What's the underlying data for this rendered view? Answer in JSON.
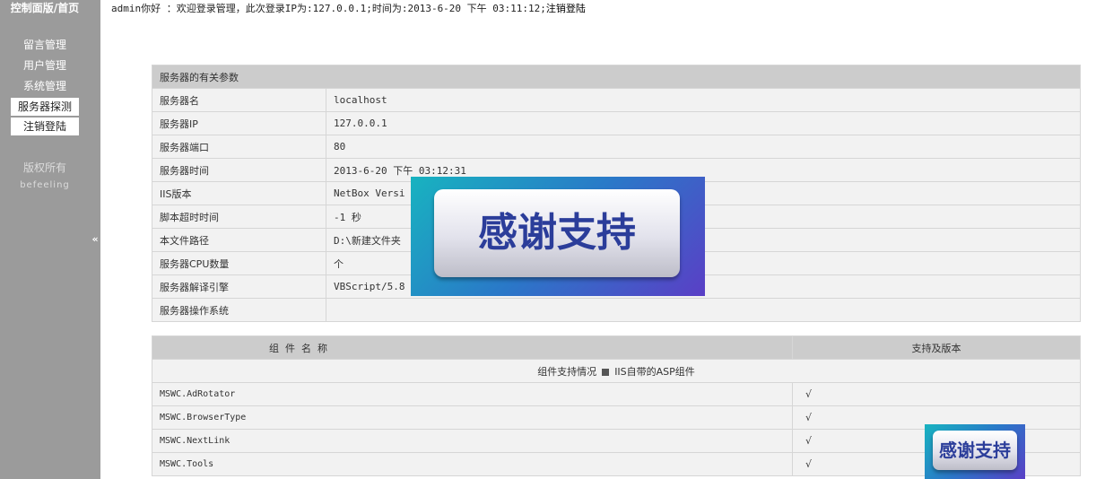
{
  "sidebar": {
    "title": "控制面版/首页",
    "items": [
      {
        "label": "留言管理"
      },
      {
        "label": "用户管理"
      },
      {
        "label": "系统管理"
      },
      {
        "label": "服务器探测"
      },
      {
        "label": "注销登陆"
      }
    ],
    "copyright": "版权所有",
    "author": "befeeling",
    "collapse_glyph": "«"
  },
  "topbar": {
    "welcome": "admin你好 ：欢迎登录管理，此次登录IP为:127.0.0.1;时间为:2013-6-20 下午 03:11:12;",
    "logout": "注销登陆"
  },
  "server_table": {
    "header": "服务器的有关参数",
    "rows": [
      {
        "label": "服务器名",
        "value": "localhost"
      },
      {
        "label": "服务器IP",
        "value": "127.0.0.1"
      },
      {
        "label": "服务器端口",
        "value": "80"
      },
      {
        "label": "服务器时间",
        "value": "2013-6-20 下午 03:12:31"
      },
      {
        "label": "IIS版本",
        "value": "NetBox Versi"
      },
      {
        "label": "脚本超时时间",
        "value": "-1 秒"
      },
      {
        "label": "本文件路径",
        "value": "D:\\新建文件夹"
      },
      {
        "label": "服务器CPU数量",
        "value": " 个"
      },
      {
        "label": "服务器解译引擎",
        "value": "VBScript/5.8"
      },
      {
        "label": "服务器操作系统",
        "value": ""
      }
    ]
  },
  "component_table": {
    "col_name": "组件名称",
    "col_support": "支持及版本",
    "subheader_left": "组件支持情况",
    "subheader_right": "IIS自带的ASP组件",
    "rows": [
      {
        "name": "MSWC.AdRotator",
        "support": "√"
      },
      {
        "name": "MSWC.BrowserType",
        "support": "√"
      },
      {
        "name": "MSWC.NextLink",
        "support": "√"
      },
      {
        "name": "MSWC.Tools",
        "support": "√"
      }
    ]
  },
  "badges": {
    "large": "感谢支持",
    "small": "感谢支持"
  },
  "colors": {
    "sidebar_bg": "#9b9b9b",
    "table_header_bg": "#cccccc",
    "table_cell_bg": "#f2f2f2",
    "badge_text": "#2b3d9a"
  }
}
